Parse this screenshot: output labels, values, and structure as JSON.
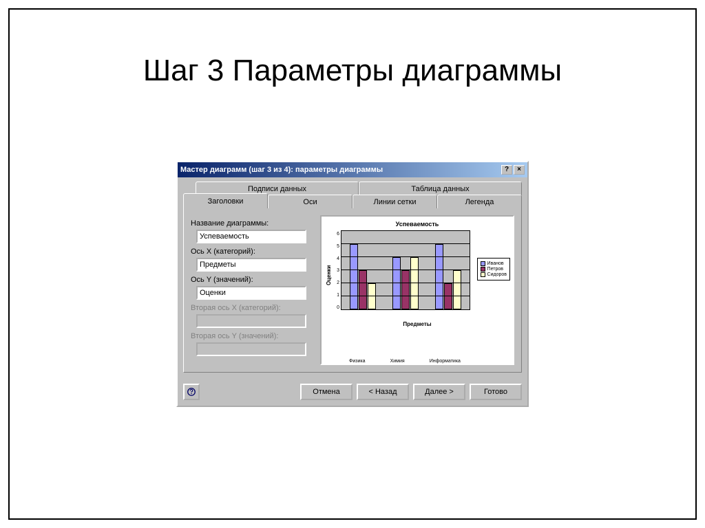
{
  "slide": {
    "title": "Шаг 3 Параметры диаграммы"
  },
  "dialog": {
    "title": "Мастер диаграмм (шаг 3 из 4): параметры диаграммы",
    "tabs_row2": [
      "Подписи данных",
      "Таблица данных"
    ],
    "tabs_row1": [
      "Заголовки",
      "Оси",
      "Линии сетки",
      "Легенда"
    ],
    "active_tab": "Заголовки",
    "fields": {
      "chart_title_label": "Название диаграммы:",
      "chart_title_value": "Успеваемость",
      "x_label": "Ось X (категорий):",
      "x_value": "Предметы",
      "y_label": "Ось Y (значений):",
      "y_value": "Оценки",
      "x2_label": "Вторая ось X (категорий):",
      "x2_value": "",
      "y2_label": "Вторая ось Y (значений):",
      "y2_value": ""
    },
    "buttons": {
      "cancel": "Отмена",
      "back": "< Назад",
      "next": "Далее >",
      "finish": "Готово"
    },
    "help_tooltip": "?",
    "close_tooltip": "×"
  },
  "chart_data": {
    "type": "bar",
    "title": "Успеваемость",
    "xlabel": "Предметы",
    "ylabel": "Оценки",
    "categories": [
      "Физика",
      "Химия",
      "Информатика"
    ],
    "series": [
      {
        "name": "Иванов",
        "values": [
          5,
          4,
          5
        ]
      },
      {
        "name": "Петров",
        "values": [
          3,
          3,
          2
        ]
      },
      {
        "name": "Сидоров",
        "values": [
          2,
          4,
          3
        ]
      }
    ],
    "ylim": [
      0,
      6
    ],
    "y_ticks": [
      0,
      1,
      2,
      3,
      4,
      5,
      6
    ],
    "legend_names": [
      "Иванов",
      "Петров",
      "Сидоров"
    ],
    "colors": {
      "s0": "#9999ff",
      "s1": "#993366",
      "s2": "#ffffcc"
    }
  }
}
